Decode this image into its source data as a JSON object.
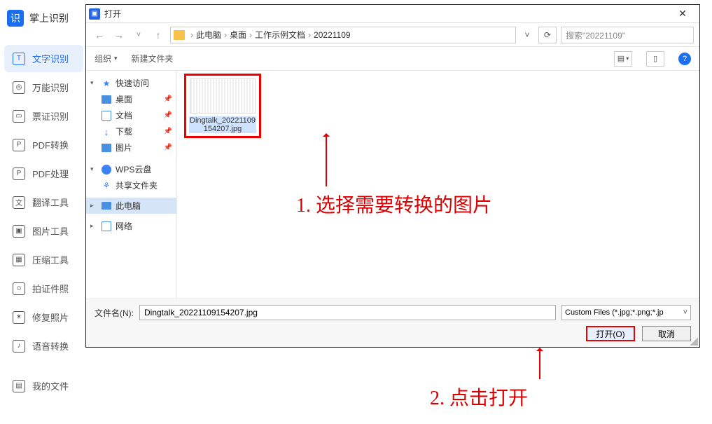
{
  "app": {
    "title": "掌上识别",
    "menu": [
      {
        "label": "文字识别",
        "active": true
      },
      {
        "label": "万能识别"
      },
      {
        "label": "票证识别"
      },
      {
        "label": "PDF转换"
      },
      {
        "label": "PDF处理"
      },
      {
        "label": "翻译工具"
      },
      {
        "label": "图片工具"
      },
      {
        "label": "压缩工具"
      },
      {
        "label": "拍证件照"
      },
      {
        "label": "修复照片"
      },
      {
        "label": "语音转换"
      },
      {
        "label": "我的文件"
      }
    ]
  },
  "dialog": {
    "title": "打开",
    "breadcrumb": [
      "此电脑",
      "桌面",
      "工作示例文档",
      "20221109"
    ],
    "search_placeholder": "搜索\"20221109\"",
    "toolbar": {
      "organize": "组织",
      "new_folder": "新建文件夹"
    },
    "tree": {
      "quick_access": "快速访问",
      "desktop": "桌面",
      "documents": "文档",
      "downloads": "下载",
      "pictures": "图片",
      "wps": "WPS云盘",
      "shared": "共享文件夹",
      "this_pc": "此电脑",
      "network": "网络"
    },
    "file": {
      "name": "Dingtalk_20221109154207.jpg"
    },
    "footer": {
      "filename_label": "文件名(N):",
      "filename_value": "Dingtalk_20221109154207.jpg",
      "filetype": "Custom Files (*.jpg;*.png;*.jp",
      "open_btn": "打开(O)",
      "cancel_btn": "取消"
    }
  },
  "annotations": {
    "step1": "1. 选择需要转换的图片",
    "step2": "2. 点击打开"
  }
}
